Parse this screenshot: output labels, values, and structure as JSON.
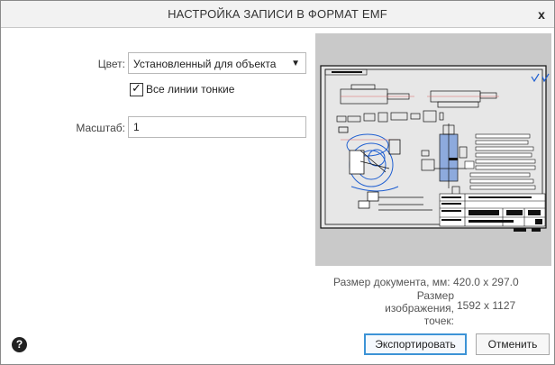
{
  "window": {
    "title": "НАСТРОЙКА ЗАПИСИ В ФОРМАТ EMF",
    "close_glyph": "x"
  },
  "form": {
    "color_label": "Цвет:",
    "color_value": "Установленный для объекта",
    "thin_lines_label": "Все линии тонкие",
    "thin_lines_checked": true,
    "scale_label": "Масштаб:",
    "scale_value": "1"
  },
  "info": {
    "doc_size_label": "Размер документа, мм:",
    "doc_size_value": "420.0 x 297.0",
    "image_size_label_1": "Размер изображения,",
    "image_size_label_2": "точек:",
    "image_size_value": "1592 x 1127"
  },
  "buttons": {
    "export_label": "Экспортировать",
    "cancel_label": "Отменить",
    "help_glyph": "?"
  },
  "colors": {
    "accent": "#3c93d6",
    "preview_bg": "#c9c9c9",
    "drawing_lines": "#1f5fd1"
  },
  "icons": {
    "dropdown": "chevron-down-icon",
    "help": "help-icon",
    "close": "close-icon",
    "check": "check-icon"
  }
}
